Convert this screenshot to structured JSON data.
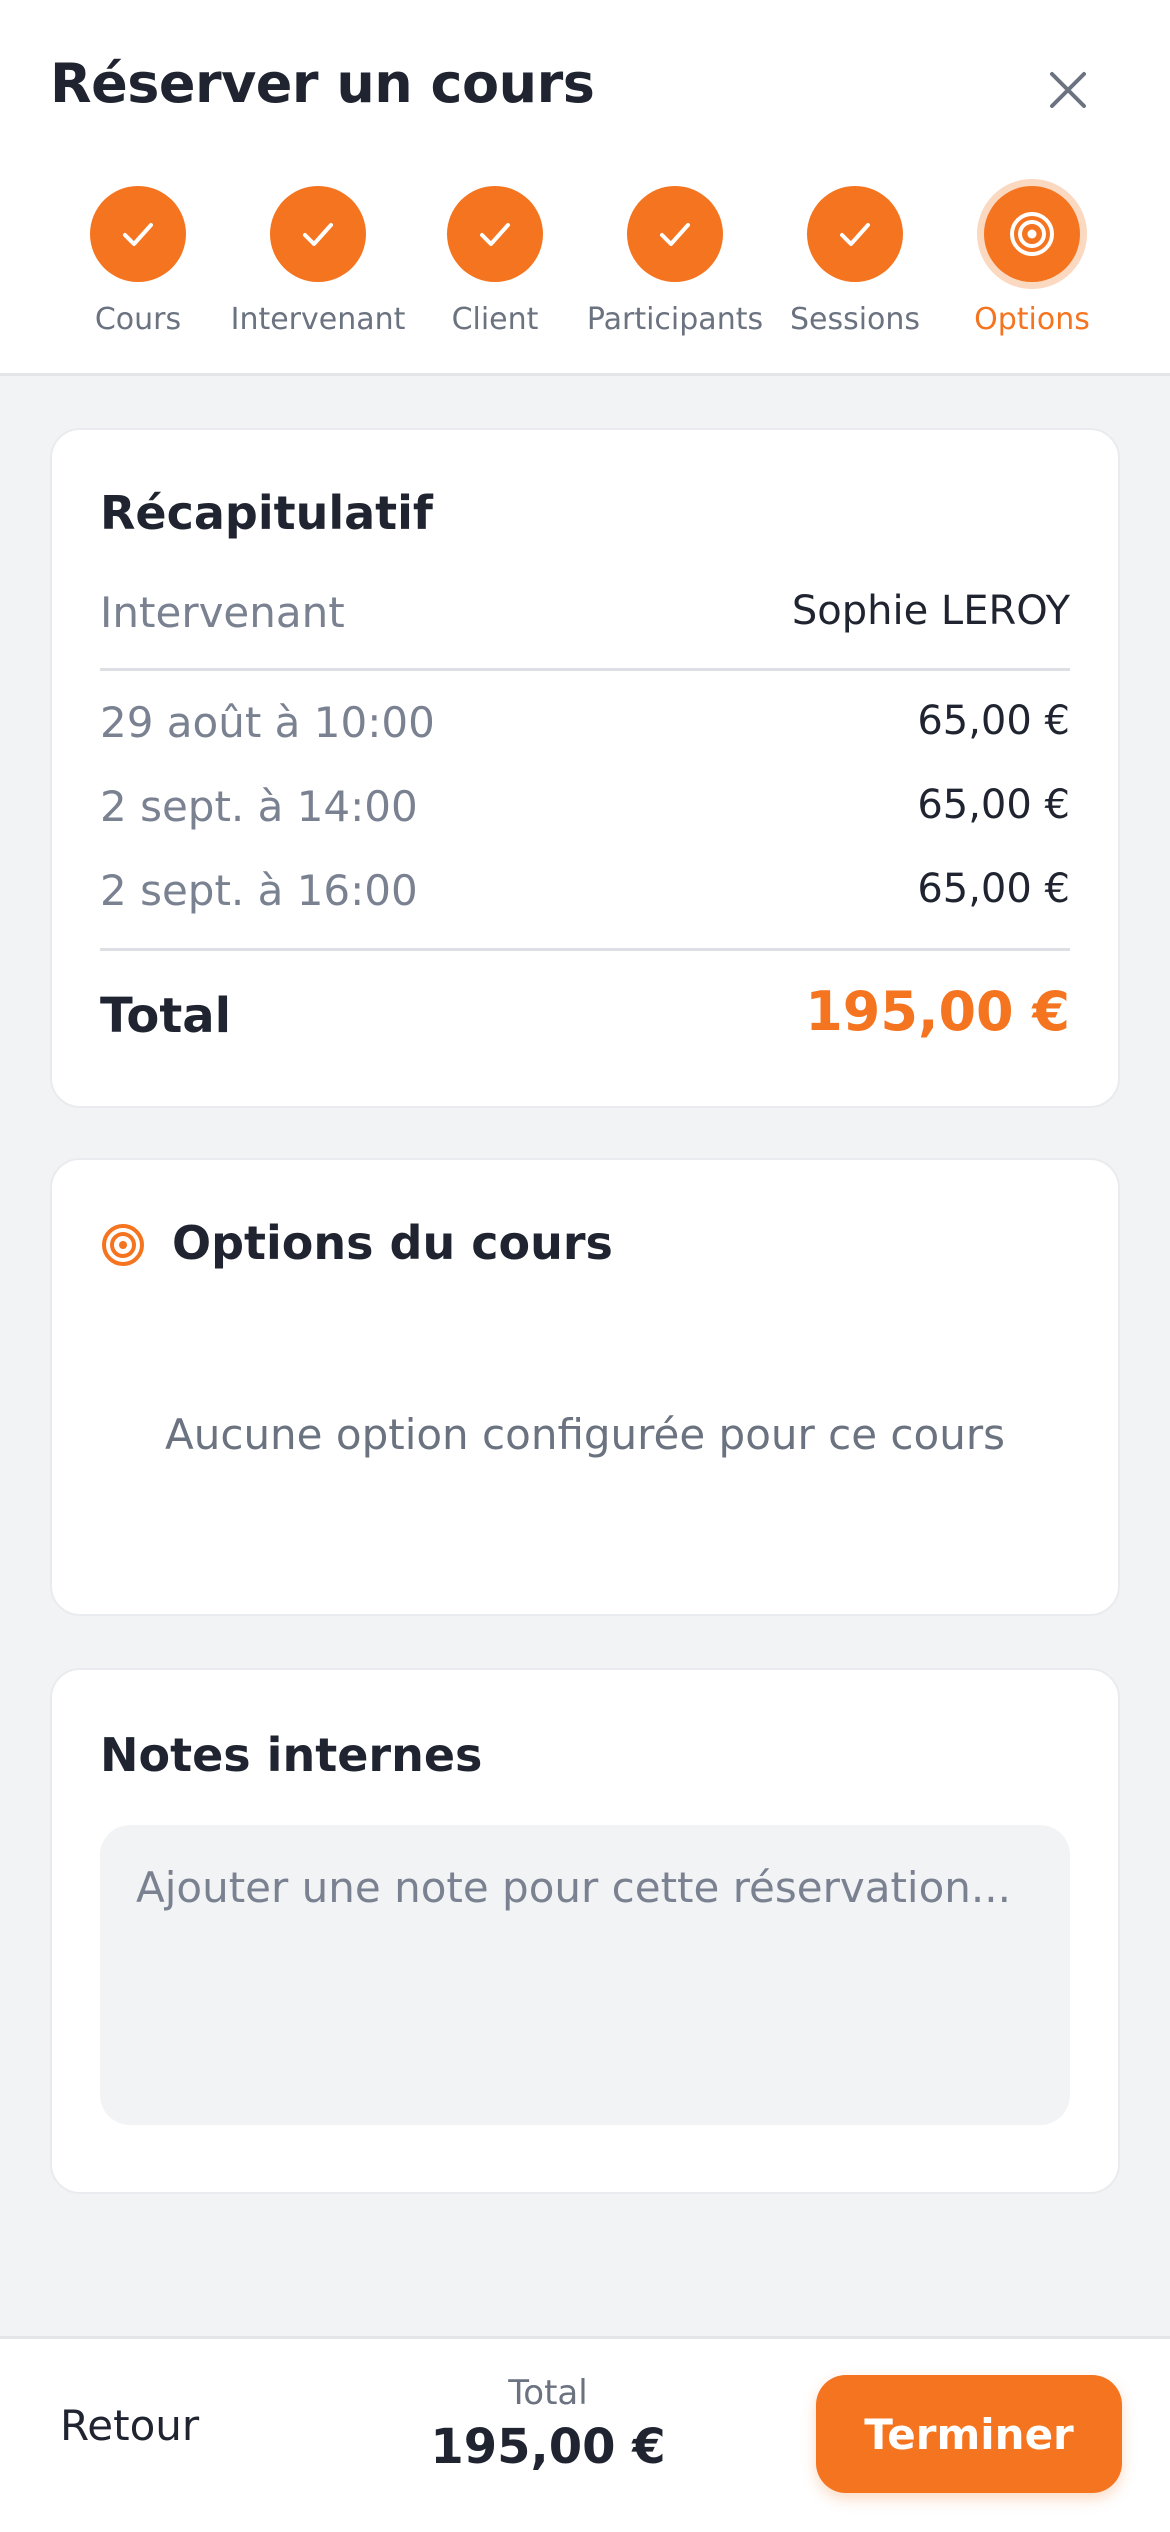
{
  "header": {
    "title": "Réserver un cours",
    "close_icon": "close-icon"
  },
  "steps": [
    {
      "label": "Cours",
      "state": "done",
      "icon": "check-icon"
    },
    {
      "label": "Intervenant",
      "state": "done",
      "icon": "check-icon"
    },
    {
      "label": "Client",
      "state": "done",
      "icon": "check-icon"
    },
    {
      "label": "Participants",
      "state": "done",
      "icon": "check-icon"
    },
    {
      "label": "Sessions",
      "state": "done",
      "icon": "check-icon"
    },
    {
      "label": "Options",
      "state": "active",
      "icon": "target-icon"
    }
  ],
  "summary": {
    "title": "Récapitulatif",
    "instructor_label": "Intervenant",
    "instructor_value": "Sophie LEROY",
    "sessions": [
      {
        "date": "29 août à 10:00",
        "price": "65,00 €"
      },
      {
        "date": "2 sept. à 14:00",
        "price": "65,00 €"
      },
      {
        "date": "2 sept. à 16:00",
        "price": "65,00 €"
      }
    ],
    "total_label": "Total",
    "total_value": "195,00 €"
  },
  "options": {
    "title": "Options du cours",
    "icon": "target-icon",
    "empty_text": "Aucune option configurée pour ce cours"
  },
  "notes": {
    "title": "Notes internes",
    "value": "",
    "placeholder": "Ajouter une note pour cette réservation..."
  },
  "footer": {
    "back_label": "Retour",
    "total_label": "Total",
    "total_value": "195,00 €",
    "finish_label": "Terminer"
  },
  "colors": {
    "accent": "#f5741f",
    "accent_soft": "#fbd8c0",
    "background": "#f2f3f5",
    "text": "#1f2430",
    "muted": "#6b7280"
  }
}
